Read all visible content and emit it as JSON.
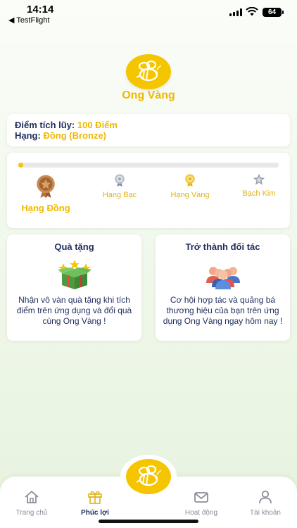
{
  "status_bar": {
    "time": "14:14",
    "back_app": "◀ TestFlight",
    "battery": "64"
  },
  "brand": {
    "name": "Ong Vàng",
    "logo_icon": "bee-icon",
    "color": "#f5c500"
  },
  "points": {
    "label": "Điểm tích lũy:",
    "value": "100 Điểm",
    "rank_label": "Hạng:",
    "rank_value": "Đồng (Bronze)"
  },
  "progress": {
    "fraction": 0.02,
    "tiers": [
      {
        "label": "Hạng Đồng",
        "icon": "bronze-medal-icon",
        "active": true
      },
      {
        "label": "Hạng Bạc",
        "icon": "silver-medal-icon",
        "active": false
      },
      {
        "label": "Hạng Vàng",
        "icon": "gold-medal-icon",
        "active": false
      },
      {
        "label": "Bạch Kim",
        "icon": "platinum-star-icon",
        "active": false
      }
    ]
  },
  "features": [
    {
      "title": "Quà tặng",
      "icon": "gift-box-icon",
      "description": "Nhận vô vàn quà tặng khi tích điểm trên ứng dụng và đổi quà cùng Ong Vàng !"
    },
    {
      "title": "Trở thành đối tác",
      "icon": "partners-icon",
      "description": "Cơ hội hợp tác và quảng bá thương hiệu của bạn trên ứng dụng Ong Vàng ngay hôm nay !"
    }
  ],
  "bottom_nav": {
    "items": [
      {
        "label": "Trang chủ",
        "icon": "home-icon",
        "active": false
      },
      {
        "label": "Phúc lợi",
        "icon": "gift-icon",
        "active": true
      },
      {
        "label": "Hoạt động",
        "icon": "mail-icon",
        "active": false
      },
      {
        "label": "Tài khoản",
        "icon": "user-icon",
        "active": false
      }
    ]
  }
}
